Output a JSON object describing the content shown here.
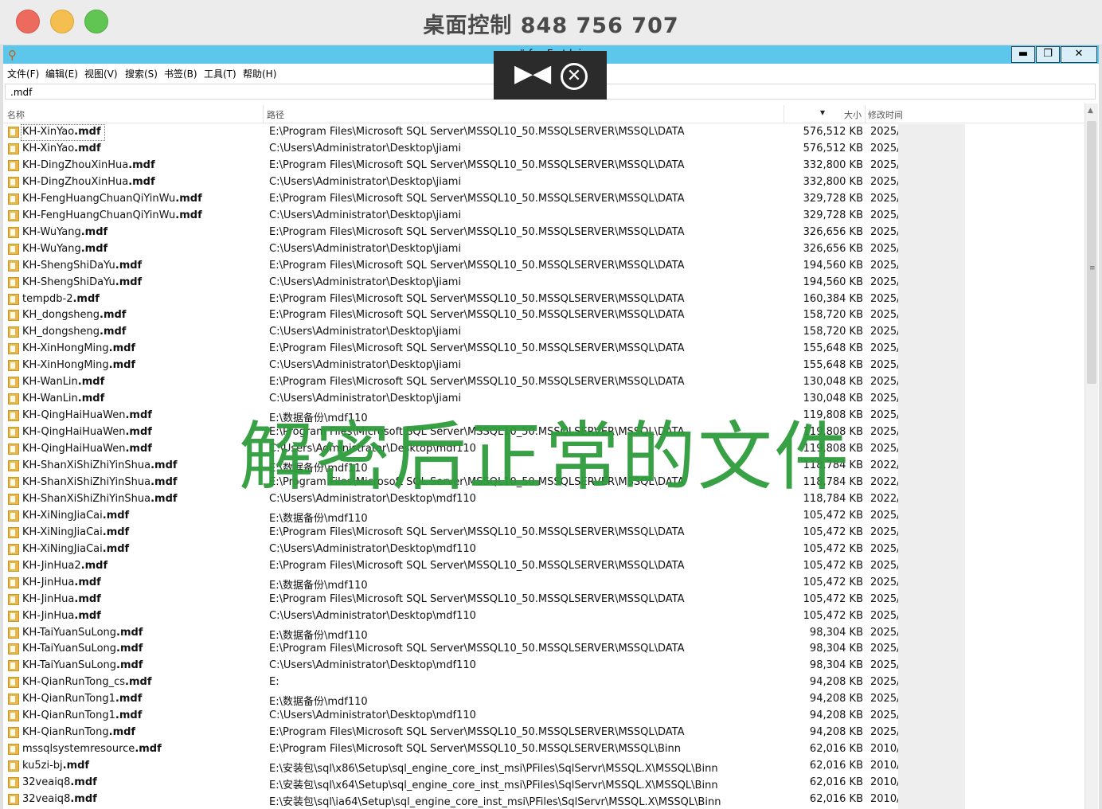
{
  "mac_window": {
    "title": "桌面控制 848 756 707"
  },
  "app_window": {
    "partial_title": "#f. E thi",
    "buttons": {
      "minimize": "▬",
      "maximize": "❐",
      "close": "✕"
    }
  },
  "menu": [
    "文件(F)",
    "编辑(E)",
    "视图(V)",
    "搜索(S)",
    "书签(B)",
    "工具(T)",
    "帮助(H)"
  ],
  "search": {
    "value": ".mdf"
  },
  "columns": {
    "name": "名称",
    "path": "路径",
    "sort_indicator": "▾",
    "size": "大小",
    "modified": "修改时间"
  },
  "rows": [
    {
      "name": "KH-XinYao",
      "ext": ".mdf",
      "path": "E:\\Program Files\\Microsoft SQL Server\\MSSQL10_50.MSSQLSERVER\\MSSQL\\DATA",
      "size": "576,512 KB",
      "date": "2025/"
    },
    {
      "name": "KH-XinYao",
      "ext": ".mdf",
      "path": "C:\\Users\\Administrator\\Desktop\\jiami",
      "size": "576,512 KB",
      "date": "2025/"
    },
    {
      "name": "KH-DingZhouXinHua",
      "ext": ".mdf",
      "path": "E:\\Program Files\\Microsoft SQL Server\\MSSQL10_50.MSSQLSERVER\\MSSQL\\DATA",
      "size": "332,800 KB",
      "date": "2025/"
    },
    {
      "name": "KH-DingZhouXinHua",
      "ext": ".mdf",
      "path": "C:\\Users\\Administrator\\Desktop\\jiami",
      "size": "332,800 KB",
      "date": "2025/"
    },
    {
      "name": "KH-FengHuangChuanQiYinWu",
      "ext": ".mdf",
      "path": "E:\\Program Files\\Microsoft SQL Server\\MSSQL10_50.MSSQLSERVER\\MSSQL\\DATA",
      "size": "329,728 KB",
      "date": "2025/"
    },
    {
      "name": "KH-FengHuangChuanQiYinWu",
      "ext": ".mdf",
      "path": "C:\\Users\\Administrator\\Desktop\\jiami",
      "size": "329,728 KB",
      "date": "2025/"
    },
    {
      "name": "KH-WuYang",
      "ext": ".mdf",
      "path": "E:\\Program Files\\Microsoft SQL Server\\MSSQL10_50.MSSQLSERVER\\MSSQL\\DATA",
      "size": "326,656 KB",
      "date": "2025/"
    },
    {
      "name": "KH-WuYang",
      "ext": ".mdf",
      "path": "C:\\Users\\Administrator\\Desktop\\jiami",
      "size": "326,656 KB",
      "date": "2025/"
    },
    {
      "name": "KH-ShengShiDaYu",
      "ext": ".mdf",
      "path": "E:\\Program Files\\Microsoft SQL Server\\MSSQL10_50.MSSQLSERVER\\MSSQL\\DATA",
      "size": "194,560 KB",
      "date": "2025/"
    },
    {
      "name": "KH-ShengShiDaYu",
      "ext": ".mdf",
      "path": "C:\\Users\\Administrator\\Desktop\\jiami",
      "size": "194,560 KB",
      "date": "2025/"
    },
    {
      "name": "tempdb-2",
      "ext": ".mdf",
      "path": "E:\\Program Files\\Microsoft SQL Server\\MSSQL10_50.MSSQLSERVER\\MSSQL\\DATA",
      "size": "160,384 KB",
      "date": "2025/"
    },
    {
      "name": "KH_dongsheng",
      "ext": ".mdf",
      "path": "E:\\Program Files\\Microsoft SQL Server\\MSSQL10_50.MSSQLSERVER\\MSSQL\\DATA",
      "size": "158,720 KB",
      "date": "2025/"
    },
    {
      "name": "KH_dongsheng",
      "ext": ".mdf",
      "path": "C:\\Users\\Administrator\\Desktop\\jiami",
      "size": "158,720 KB",
      "date": "2025/"
    },
    {
      "name": "KH-XinHongMing",
      "ext": ".mdf",
      "path": "E:\\Program Files\\Microsoft SQL Server\\MSSQL10_50.MSSQLSERVER\\MSSQL\\DATA",
      "size": "155,648 KB",
      "date": "2025/"
    },
    {
      "name": "KH-XinHongMing",
      "ext": ".mdf",
      "path": "C:\\Users\\Administrator\\Desktop\\jiami",
      "size": "155,648 KB",
      "date": "2025/"
    },
    {
      "name": "KH-WanLin",
      "ext": ".mdf",
      "path": "E:\\Program Files\\Microsoft SQL Server\\MSSQL10_50.MSSQLSERVER\\MSSQL\\DATA",
      "size": "130,048 KB",
      "date": "2025/"
    },
    {
      "name": "KH-WanLin",
      "ext": ".mdf",
      "path": "C:\\Users\\Administrator\\Desktop\\jiami",
      "size": "130,048 KB",
      "date": "2025/"
    },
    {
      "name": "KH-QingHaiHuaWen",
      "ext": ".mdf",
      "path": "E:\\数据备份\\mdf110",
      "size": "119,808 KB",
      "date": "2025/"
    },
    {
      "name": "KH-QingHaiHuaWen",
      "ext": ".mdf",
      "path": "E:\\Program Files\\Microsoft SQL Server\\MSSQL10_50.MSSQLSERVER\\MSSQL\\DATA",
      "size": "119,808 KB",
      "date": "2025/"
    },
    {
      "name": "KH-QingHaiHuaWen",
      "ext": ".mdf",
      "path": "C:\\Users\\Administrator\\Desktop\\mdf110",
      "size": "119,808 KB",
      "date": "2025/"
    },
    {
      "name": "KH-ShanXiShiZhiYinShua",
      "ext": ".mdf",
      "path": "E:\\数据备份\\mdf110",
      "size": "118,784 KB",
      "date": "2022/"
    },
    {
      "name": "KH-ShanXiShiZhiYinShua",
      "ext": ".mdf",
      "path": "E:\\Program Files\\Microsoft SQL Server\\MSSQL10_50.MSSQLSERVER\\MSSQL\\DATA",
      "size": "118,784 KB",
      "date": "2022/"
    },
    {
      "name": "KH-ShanXiShiZhiYinShua",
      "ext": ".mdf",
      "path": "C:\\Users\\Administrator\\Desktop\\mdf110",
      "size": "118,784 KB",
      "date": "2022/"
    },
    {
      "name": "KH-XiNingJiaCai",
      "ext": ".mdf",
      "path": "E:\\数据备份\\mdf110",
      "size": "105,472 KB",
      "date": "2025/"
    },
    {
      "name": "KH-XiNingJiaCai",
      "ext": ".mdf",
      "path": "E:\\Program Files\\Microsoft SQL Server\\MSSQL10_50.MSSQLSERVER\\MSSQL\\DATA",
      "size": "105,472 KB",
      "date": "2025/"
    },
    {
      "name": "KH-XiNingJiaCai",
      "ext": ".mdf",
      "path": "C:\\Users\\Administrator\\Desktop\\mdf110",
      "size": "105,472 KB",
      "date": "2025/"
    },
    {
      "name": "KH-JinHua2",
      "ext": ".mdf",
      "path": "E:\\Program Files\\Microsoft SQL Server\\MSSQL10_50.MSSQLSERVER\\MSSQL\\DATA",
      "size": "105,472 KB",
      "date": "2025/"
    },
    {
      "name": "KH-JinHua",
      "ext": ".mdf",
      "path": "E:\\数据备份\\mdf110",
      "size": "105,472 KB",
      "date": "2025/"
    },
    {
      "name": "KH-JinHua",
      "ext": ".mdf",
      "path": "E:\\Program Files\\Microsoft SQL Server\\MSSQL10_50.MSSQLSERVER\\MSSQL\\DATA",
      "size": "105,472 KB",
      "date": "2025/"
    },
    {
      "name": "KH-JinHua",
      "ext": ".mdf",
      "path": "C:\\Users\\Administrator\\Desktop\\mdf110",
      "size": "105,472 KB",
      "date": "2025/"
    },
    {
      "name": "KH-TaiYuanSuLong",
      "ext": ".mdf",
      "path": "E:\\数据备份\\mdf110",
      "size": "98,304 KB",
      "date": "2025/"
    },
    {
      "name": "KH-TaiYuanSuLong",
      "ext": ".mdf",
      "path": "E:\\Program Files\\Microsoft SQL Server\\MSSQL10_50.MSSQLSERVER\\MSSQL\\DATA",
      "size": "98,304 KB",
      "date": "2025/"
    },
    {
      "name": "KH-TaiYuanSuLong",
      "ext": ".mdf",
      "path": "C:\\Users\\Administrator\\Desktop\\mdf110",
      "size": "98,304 KB",
      "date": "2025/"
    },
    {
      "name": "KH-QianRunTong_cs",
      "ext": ".mdf",
      "path": "E:",
      "size": "94,208 KB",
      "date": "2025/"
    },
    {
      "name": "KH-QianRunTong1",
      "ext": ".mdf",
      "path": "E:\\数据备份\\mdf110",
      "size": "94,208 KB",
      "date": "2025/"
    },
    {
      "name": "KH-QianRunTong1",
      "ext": ".mdf",
      "path": "C:\\Users\\Administrator\\Desktop\\mdf110",
      "size": "94,208 KB",
      "date": "2025/"
    },
    {
      "name": "KH-QianRunTong",
      "ext": ".mdf",
      "path": "E:\\Program Files\\Microsoft SQL Server\\MSSQL10_50.MSSQLSERVER\\MSSQL\\DATA",
      "size": "94,208 KB",
      "date": "2025/"
    },
    {
      "name": "mssqlsystemresource",
      "ext": ".mdf",
      "path": "E:\\Program Files\\Microsoft SQL Server\\MSSQL10_50.MSSQLSERVER\\MSSQL\\Binn",
      "size": "62,016 KB",
      "date": "2010/"
    },
    {
      "name": "ku5zi-bj",
      "ext": ".mdf",
      "path": "E:\\安装包\\sql\\x86\\Setup\\sql_engine_core_inst_msi\\PFiles\\SqlServr\\MSSQL.X\\MSSQL\\Binn",
      "size": "62,016 KB",
      "date": "2010/"
    },
    {
      "name": "32veaiq8",
      "ext": ".mdf",
      "path": "E:\\安装包\\sql\\x64\\Setup\\sql_engine_core_inst_msi\\PFiles\\SqlServr\\MSSQL.X\\MSSQL\\Binn",
      "size": "62,016 KB",
      "date": "2010/"
    },
    {
      "name": "32veaiq8",
      "ext": ".mdf",
      "path": "E:\\安装包\\sql\\ia64\\Setup\\sql_engine_core_inst_msi\\PFiles\\SqlServr\\MSSQL.X\\MSSQL\\Binn",
      "size": "62,016 KB",
      "date": "2010/"
    }
  ],
  "remote_toolbar": {
    "collapse_glyph": "▶◀",
    "close_glyph": "✕"
  },
  "overlay": {
    "caption": "解密后正常的文件"
  },
  "scrollbar": {
    "up_glyph": "▲",
    "grip_glyph": "≡"
  },
  "colors": {
    "title_bar": "#5cc7ea",
    "caption": "#2e9d3c",
    "toolbar_bg": "#2b2b2b"
  }
}
